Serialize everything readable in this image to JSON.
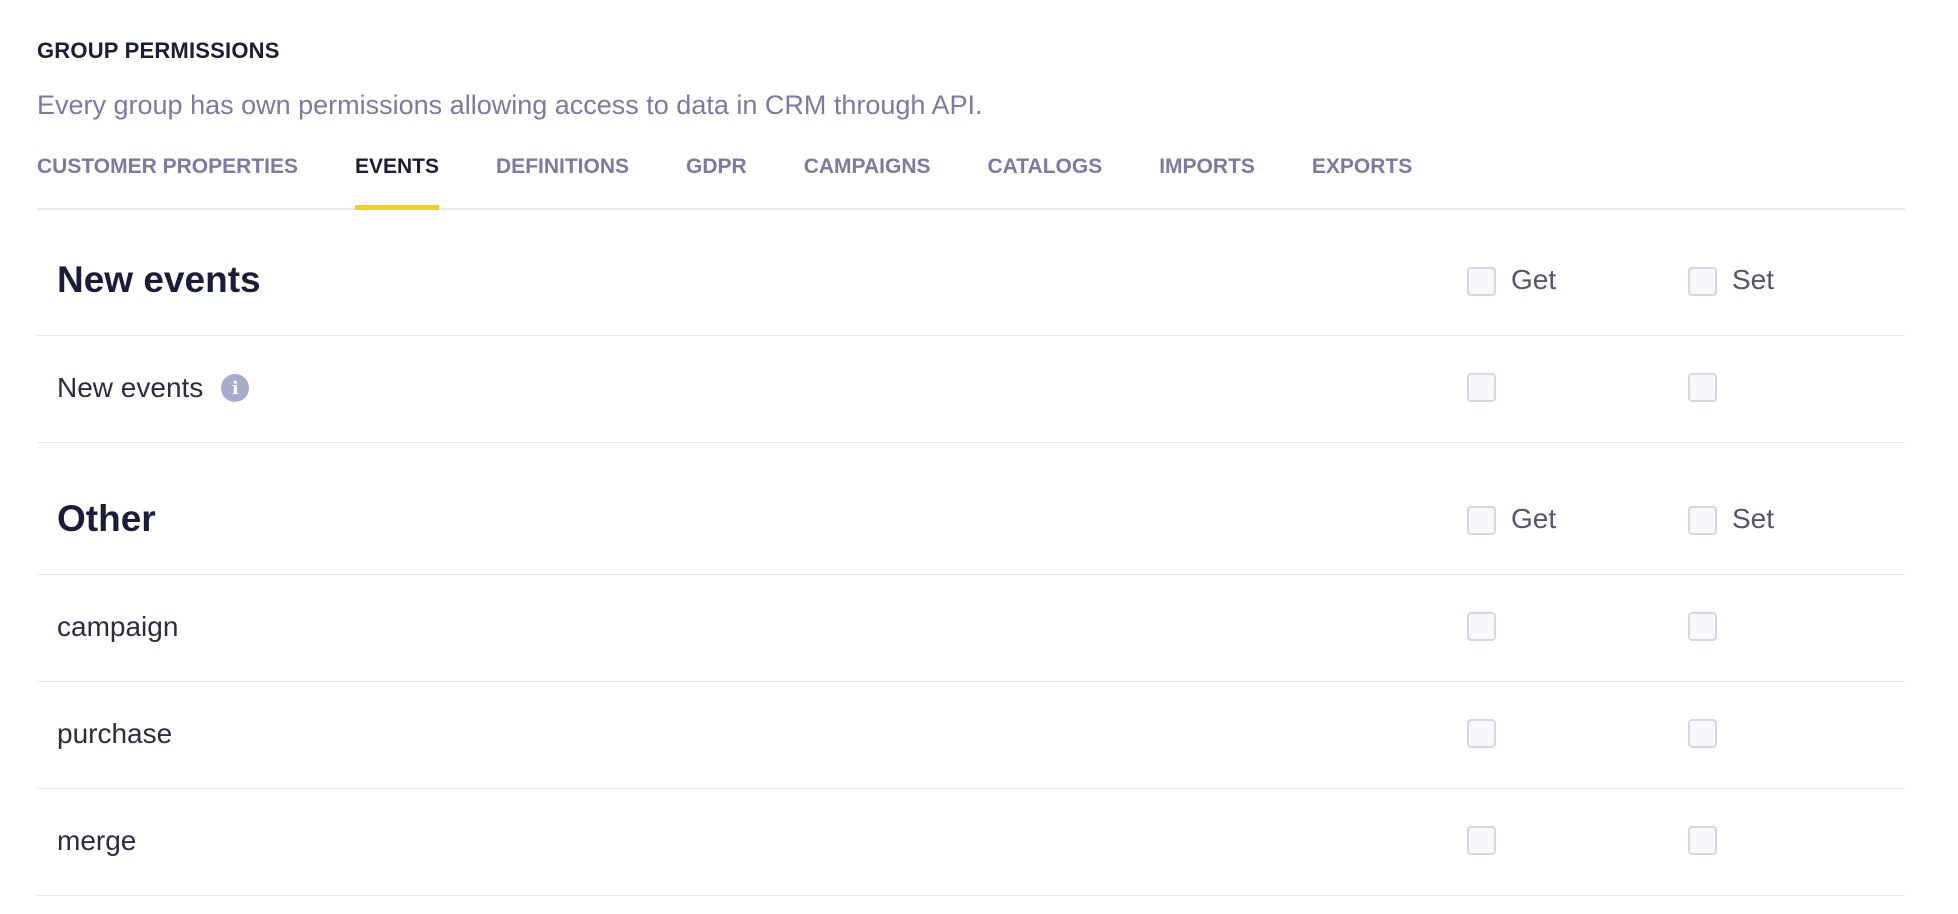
{
  "header": {
    "title": "GROUP PERMISSIONS",
    "description": "Every group has own permissions allowing access to data in CRM through API."
  },
  "tabs": [
    {
      "label": "CUSTOMER PROPERTIES"
    },
    {
      "label": "EVENTS",
      "active": true
    },
    {
      "label": "DEFINITIONS"
    },
    {
      "label": "GDPR"
    },
    {
      "label": "CAMPAIGNS"
    },
    {
      "label": "CATALOGS"
    },
    {
      "label": "IMPORTS"
    },
    {
      "label": "EXPORTS"
    }
  ],
  "sections": [
    {
      "title": "New events",
      "get_label": "Get",
      "set_label": "Set",
      "rows": [
        {
          "label": "New events",
          "info_icon": "info-icon",
          "get": false,
          "set": false
        }
      ]
    },
    {
      "title": "Other",
      "get_label": "Get",
      "set_label": "Set",
      "rows": [
        {
          "label": "campaign",
          "get": false,
          "set": false
        },
        {
          "label": "purchase",
          "get": false,
          "set": false
        },
        {
          "label": "merge",
          "get": false,
          "set": false
        }
      ]
    }
  ],
  "colors": {
    "accent_underline": "#f5d20f",
    "muted_text": "#7a7aa3",
    "dark_text": "#1b1b3a"
  }
}
